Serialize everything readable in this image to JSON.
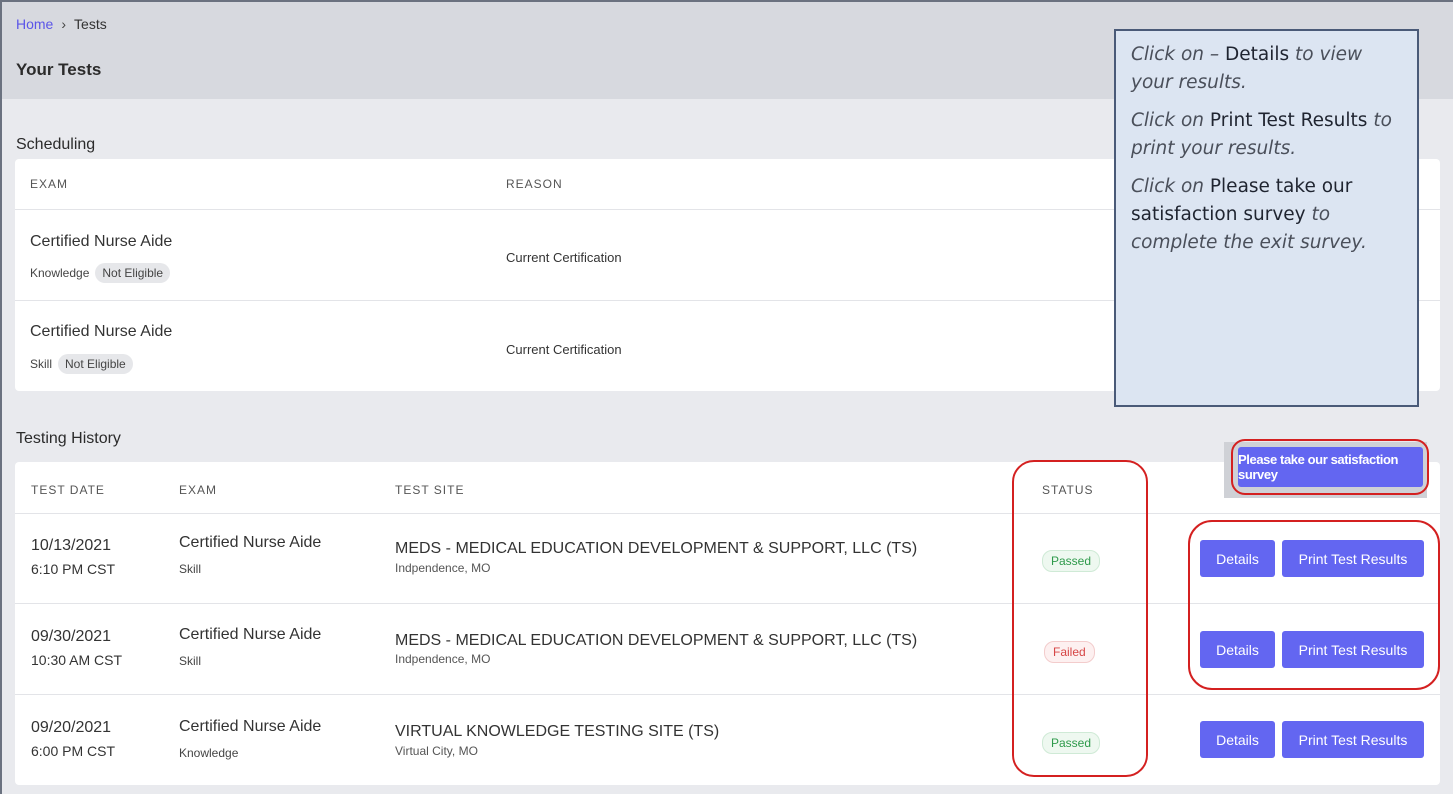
{
  "breadcrumb": {
    "home": "Home",
    "separator": "›",
    "current": "Tests"
  },
  "page_title": "Your Tests",
  "scheduling": {
    "title": "Scheduling",
    "headers": {
      "exam": "EXAM",
      "reason": "REASON"
    },
    "rows": [
      {
        "exam": "Certified Nurse Aide",
        "type": "Knowledge",
        "eligibility": "Not Eligible",
        "reason": "Current Certification"
      },
      {
        "exam": "Certified Nurse Aide",
        "type": "Skill",
        "eligibility": "Not Eligible",
        "reason": "Current Certification"
      }
    ]
  },
  "history": {
    "title": "Testing History",
    "headers": {
      "date": "TEST DATE",
      "exam": "EXAM",
      "site": "TEST SITE",
      "status": "STATUS"
    },
    "survey_button": "Please take our satisfaction survey",
    "details_label": "Details",
    "print_label": "Print Test Results",
    "rows": [
      {
        "date": "10/13/2021",
        "time": "6:10 PM CST",
        "exam": "Certified Nurse Aide",
        "type": "Skill",
        "site": "MEDS - MEDICAL EDUCATION DEVELOPMENT & SUPPORT, LLC (TS)",
        "city": "Indpendence, MO",
        "status": "Passed"
      },
      {
        "date": "09/30/2021",
        "time": "10:30 AM CST",
        "exam": "Certified Nurse Aide",
        "type": "Skill",
        "site": "MEDS - MEDICAL EDUCATION DEVELOPMENT & SUPPORT, LLC (TS)",
        "city": "Indpendence, MO",
        "status": "Failed"
      },
      {
        "date": "09/20/2021",
        "time": "6:00 PM CST",
        "exam": "Certified Nurse Aide",
        "type": "Knowledge",
        "site": "VIRTUAL KNOWLEDGE TESTING SITE (TS)",
        "city": "Virtual City, MO",
        "status": "Passed"
      }
    ]
  },
  "callout": {
    "p1_a": "Click on – ",
    "p1_b": "Details",
    "p1_c": " to view your results.",
    "p2_a": "Click on ",
    "p2_b": "Print Test Results",
    "p2_c": " to print your results.",
    "p3_a": "Click on ",
    "p3_b": "Please take our satisfaction survey",
    "p3_c": " to complete the exit survey."
  },
  "colors": {
    "accent": "#6366f1",
    "passed": "#2e9a4b",
    "failed": "#d64545",
    "highlight": "#d42020"
  }
}
